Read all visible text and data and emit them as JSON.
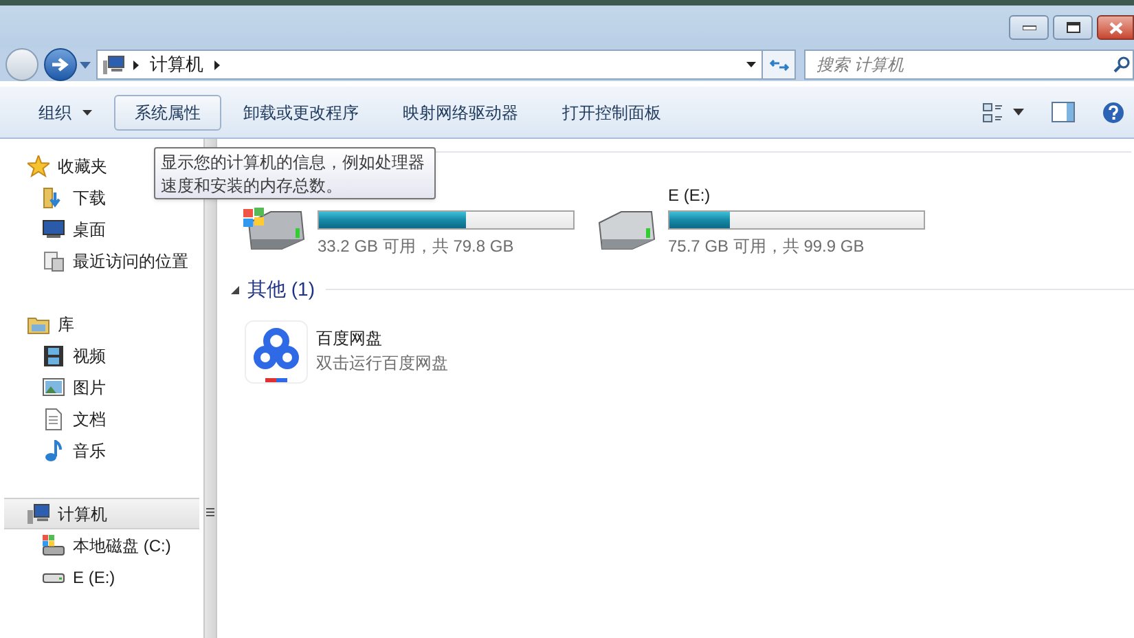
{
  "address_bar": {
    "path": [
      "计算机"
    ]
  },
  "search": {
    "placeholder": "搜索 计算机"
  },
  "toolbar": [
    {
      "label": "组织",
      "kind": "menu",
      "hovered": false
    },
    {
      "label": "系统属性",
      "kind": "button",
      "hovered": true
    },
    {
      "label": "卸载或更改程序",
      "kind": "button",
      "hovered": false
    },
    {
      "label": "映射网络驱动器",
      "kind": "button",
      "hovered": false
    },
    {
      "label": "打开控制面板",
      "kind": "button",
      "hovered": false
    }
  ],
  "tooltip": {
    "text": "显示您的计算机的信息，例如处理器速度和安装的内存总数。"
  },
  "sidebar": [
    {
      "label": "收藏夹",
      "kind": "star",
      "selected": false,
      "children": [
        {
          "label": "下载",
          "kind": "download",
          "selected": false
        },
        {
          "label": "桌面",
          "kind": "desktop",
          "selected": false
        },
        {
          "label": "最近访问的位置",
          "kind": "recent",
          "selected": false
        }
      ]
    },
    {
      "label": "库",
      "kind": "library",
      "selected": false,
      "children": [
        {
          "label": "视频",
          "kind": "video",
          "selected": false
        },
        {
          "label": "图片",
          "kind": "picture",
          "selected": false
        },
        {
          "label": "文档",
          "kind": "document",
          "selected": false
        },
        {
          "label": "音乐",
          "kind": "music",
          "selected": false
        }
      ]
    },
    {
      "label": "计算机",
      "kind": "computer",
      "selected": true,
      "children": [
        {
          "label": "本地磁盘 (C:)",
          "kind": "system_drive",
          "selected": false
        },
        {
          "label": "E (E:)",
          "kind": "drive",
          "selected": false
        }
      ]
    }
  ],
  "drives": [
    {
      "kind": "system_drive",
      "level": 0.58,
      "free": "33.2 GB 可用，共 79.8 GB"
    },
    {
      "kind": "drive",
      "name": "E (E:)",
      "level": 0.24,
      "free": "75.7 GB 可用，共 99.9 GB"
    }
  ],
  "other_group": {
    "title": "其他 (1)",
    "items": [
      {
        "name": "百度网盘",
        "description": "双击运行百度网盘"
      }
    ]
  }
}
